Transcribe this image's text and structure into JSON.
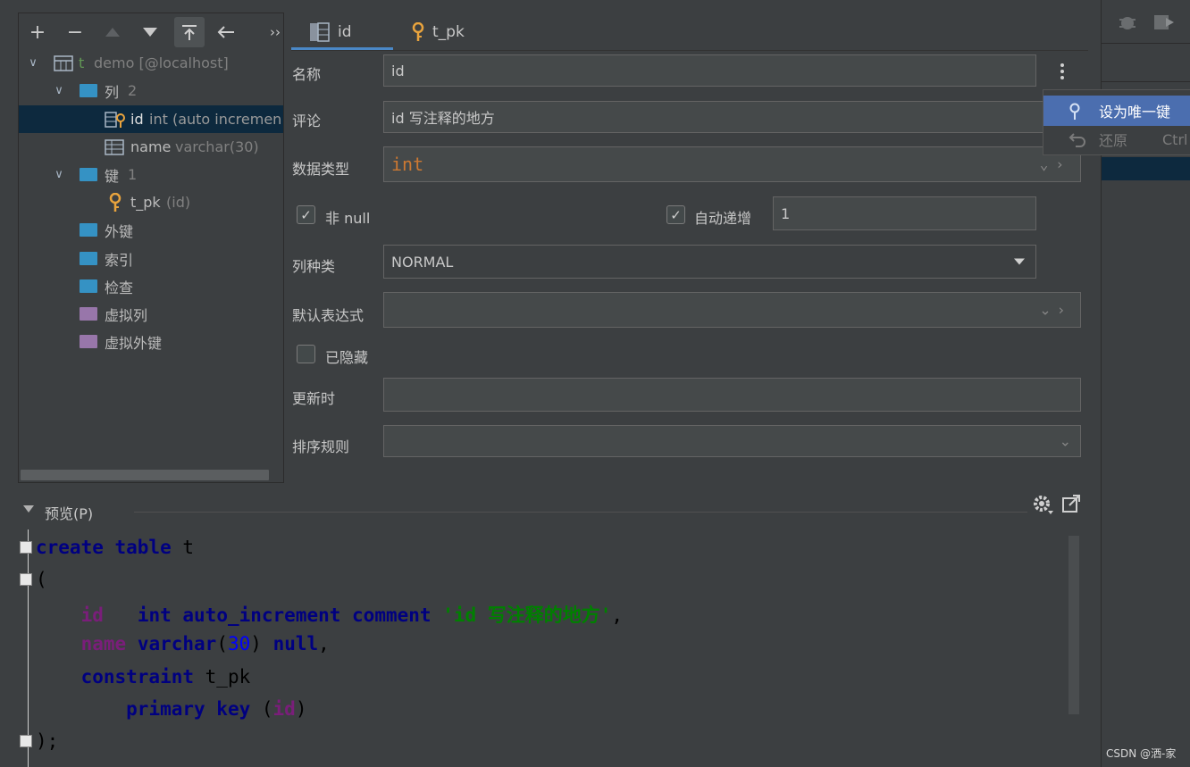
{
  "tree_toolbar": {
    "add": "+",
    "remove": "−",
    "more": "››"
  },
  "tree": {
    "table_icon_letter": "t",
    "table_name": "demo [@localhost]",
    "columns_folder": "列",
    "columns_count": "2",
    "col_id_name": "id",
    "col_id_type": "int (auto incremen",
    "col_name_name": "name",
    "col_name_type": "varchar(30)",
    "keys_folder": "键",
    "keys_count": "1",
    "key_name": "t_pk",
    "key_cols": "(id)",
    "foreign_keys": "外键",
    "indexes": "索引",
    "checks": "检查",
    "virtual_cols": "虚拟列",
    "virtual_fks": "虚拟外键"
  },
  "tabs": [
    "id",
    "t_pk"
  ],
  "form": {
    "name_label": "名称",
    "name_value": "id",
    "comment_label": "评论",
    "comment_value": "id 写注释的地方",
    "datatype_label": "数据类型",
    "datatype_value": "int",
    "not_null_label": "非 null",
    "auto_inc_label": "自动递增",
    "auto_inc_value": "1",
    "kind_label": "列种类",
    "kind_value": "NORMAL",
    "default_label": "默认表达式",
    "hidden_label": "已隐藏",
    "on_update_label": "更新时",
    "collation_label": "排序规则"
  },
  "popup": {
    "set_unique": "设为唯一键",
    "revert": "还原",
    "revert_shortcut": "Ctrl"
  },
  "preview": {
    "title": "预览(P)"
  },
  "code": {
    "l1_kw": "create table",
    "l1_rest": " t",
    "l2": "(",
    "l3_col": "id",
    "l3_kw": "int auto_increment comment",
    "l3_str": "'id 写注释的地方'",
    "l3_end": ",",
    "l4_col": "name",
    "l4_kw": "varchar",
    "l4_open": "(",
    "l4_num": "30",
    "l4_close": ") ",
    "l4_null": "null",
    "l4_end": ",",
    "l5_kw": "constraint",
    "l5_rest": " t_pk",
    "l6_kw": "primary key",
    "l6_open": " (",
    "l6_col": "id",
    "l6_close": ")",
    "l7": ");"
  },
  "watermark": "CSDN @洒-家",
  "colors": {
    "selection": "#0d293e",
    "accent": "#4a88c7",
    "popup_highlight": "#4b6eaf",
    "datatype_text": "#cc7832"
  }
}
